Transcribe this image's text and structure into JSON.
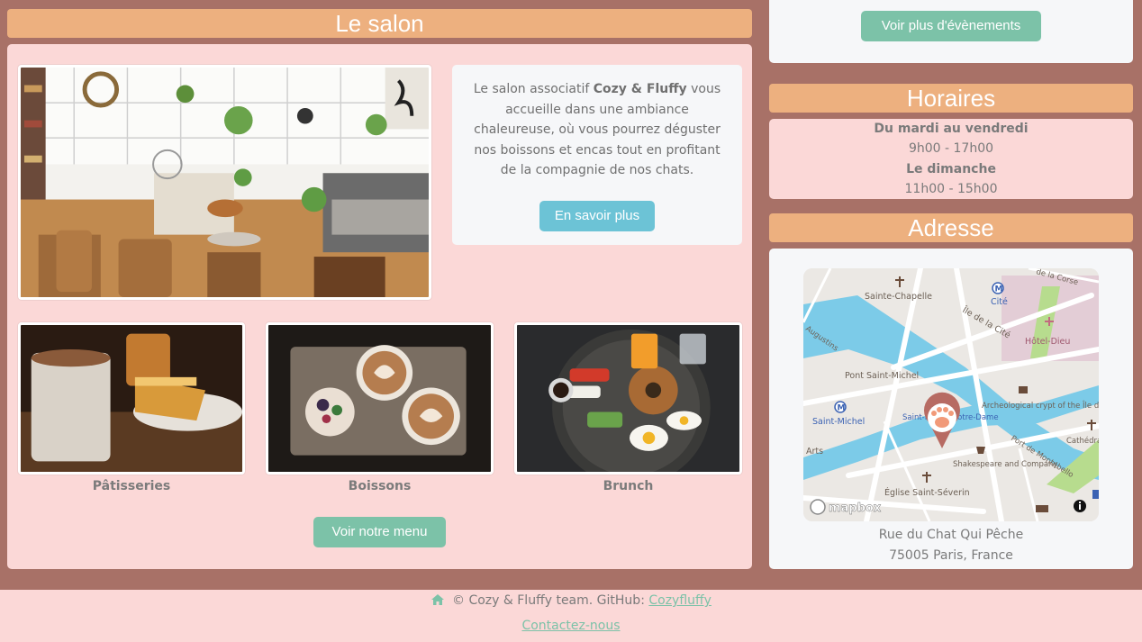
{
  "salon": {
    "title": "Le salon",
    "description_before": "Le salon associatif ",
    "brand": "Cozy & Fluffy",
    "description_after": " vous accueille dans une ambiance chaleureuse, où vous pourrez déguster nos boissons et encas tout en profitant de la compagnie de nos chats.",
    "learn_more": "En savoir plus",
    "gallery": [
      {
        "label": "Pâtisseries"
      },
      {
        "label": "Boissons"
      },
      {
        "label": "Brunch"
      }
    ],
    "menu_button": "Voir notre menu"
  },
  "events": {
    "more_button": "Voir plus d'évènements"
  },
  "hours": {
    "title": "Horaires",
    "weekday_label": "Du mardi au vendredi",
    "weekday_hours": "9h00 - 17h00",
    "sunday_label": "Le dimanche",
    "sunday_hours": "11h00 - 15h00"
  },
  "address": {
    "title": "Adresse",
    "street": "Rue du Chat Qui Pêche",
    "city": "75005 Paris, France",
    "map": {
      "attribution": "mapbox",
      "labels": [
        "Sainte-Chapelle",
        "Cité",
        "Île de la Cité",
        "Hôtel-Dieu",
        "Pont Saint-Michel",
        "Archeological crypt of the Île de la Cité",
        "Saint-Michel",
        "Saint-Michel Notre-Dame",
        "Shakespeare and Company",
        "Église Saint-Séverin",
        "Port de Montebello",
        "Cathédrale Notre-Dame",
        "Arts",
        "de la Corse",
        "Augustins"
      ]
    }
  },
  "footer": {
    "copyright": "© Cozy & Fluffy team. GitHub: ",
    "github_link": "Cozyfluffy",
    "contact_link": "Contactez-nous"
  },
  "colors": {
    "background": "#a87167",
    "pink_card": "#fbd8d7",
    "orange_title": "#edb07f",
    "green_button": "#7cc2a8",
    "blue_button": "#6cc3d6"
  }
}
